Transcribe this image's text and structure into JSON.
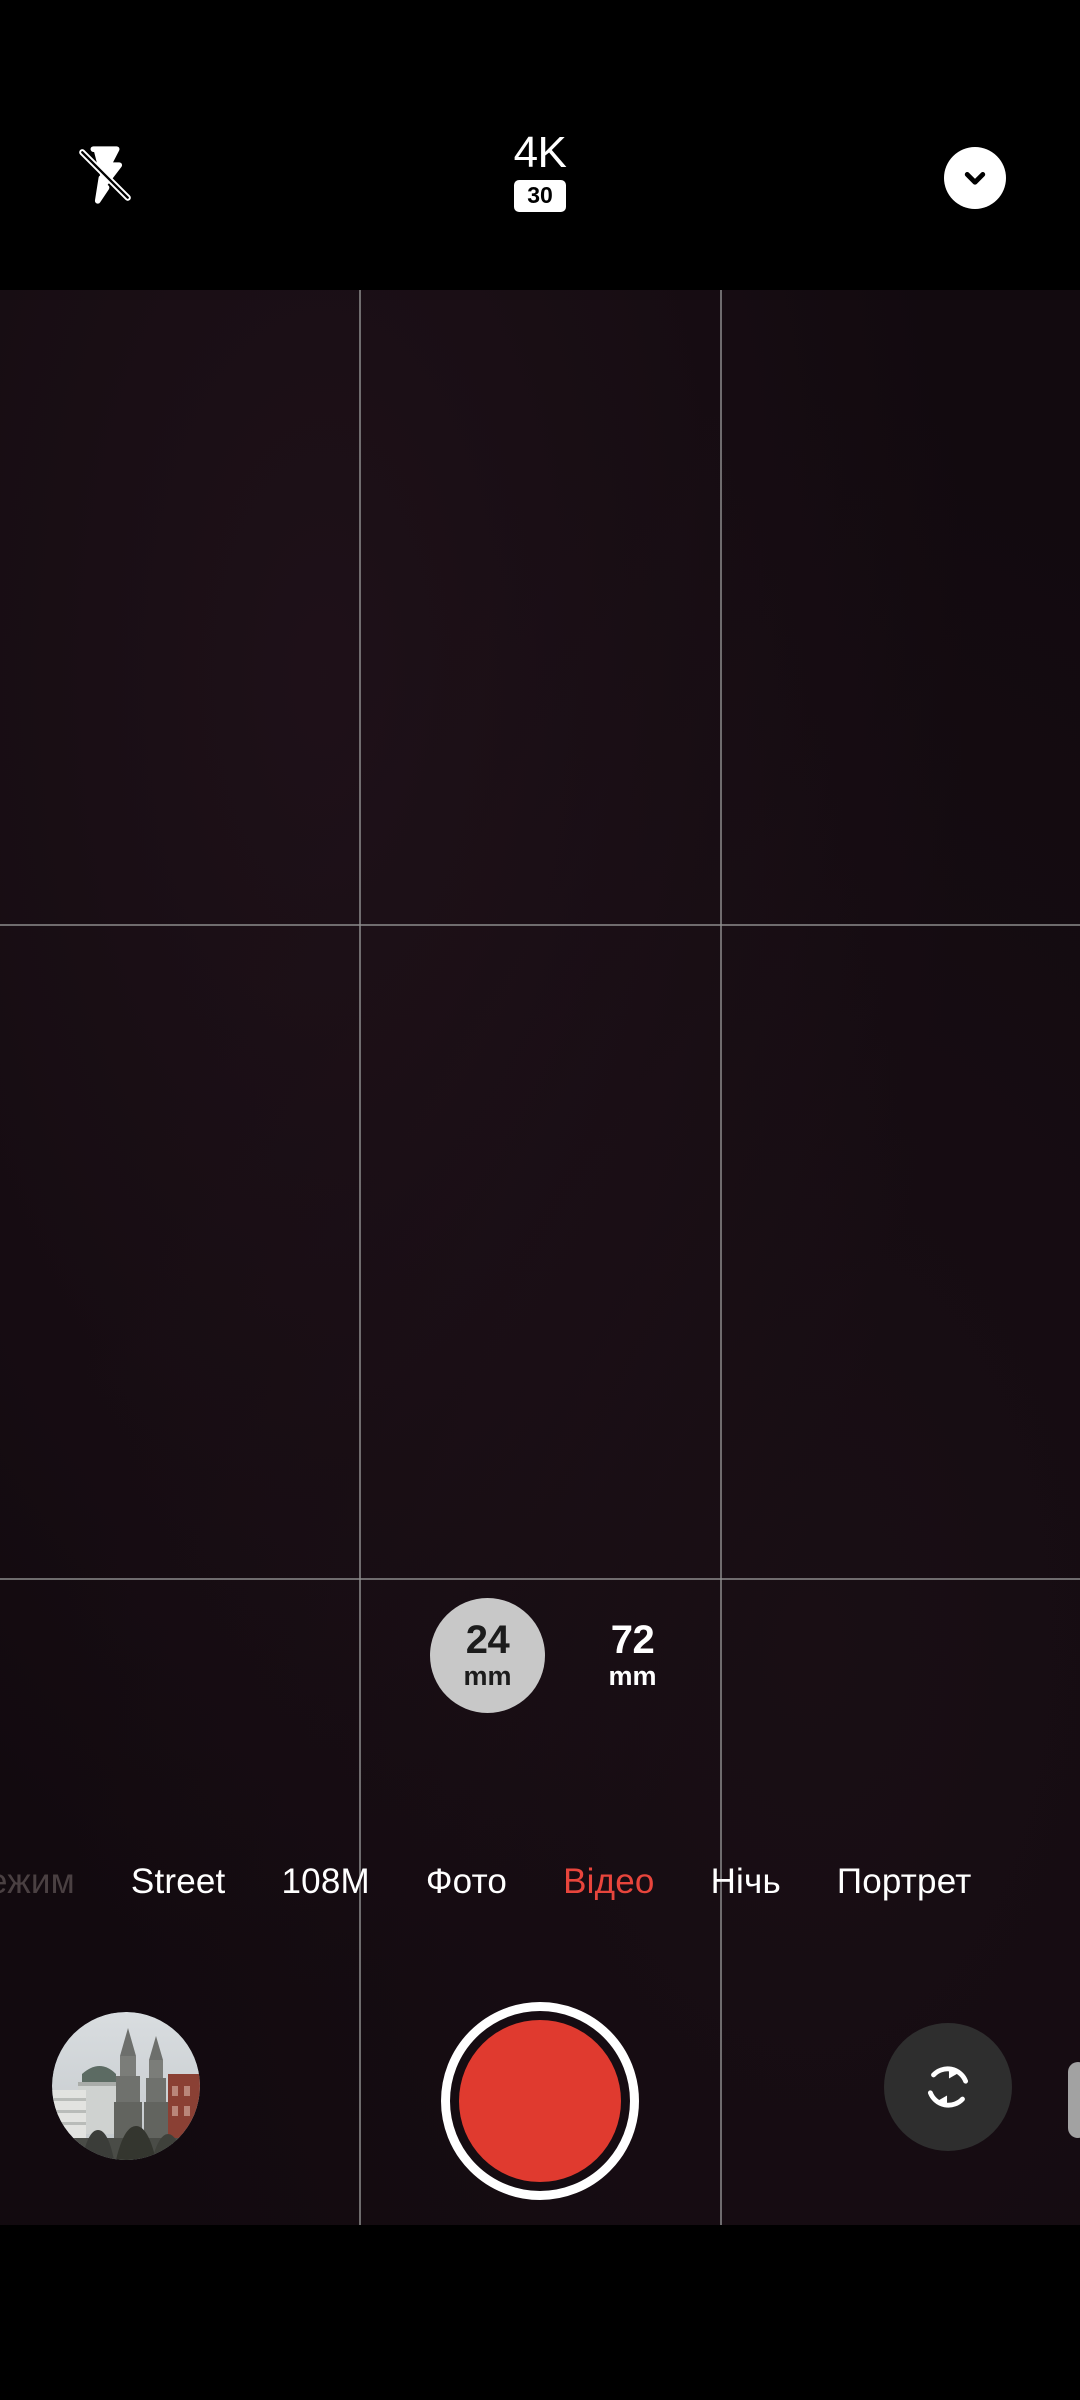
{
  "app": {
    "name": "Camera",
    "orientation": "portrait"
  },
  "status": {
    "privacy_indicator": "camera-in-use-dot",
    "privacy_color": "#1bd742"
  },
  "topbar": {
    "flash": {
      "icon": "flash-off-icon",
      "state": "off",
      "label": "Flash off"
    },
    "format": {
      "resolution": "4K",
      "fps": "30"
    },
    "expand": {
      "icon": "chevron-down-icon",
      "label": "More settings"
    }
  },
  "viewfinder": {
    "grid": {
      "enabled": true,
      "type": "3x3",
      "line_color": "#929292"
    },
    "background_color": "#120a0f"
  },
  "zoom": {
    "options": [
      {
        "value": "24",
        "unit": "mm",
        "selected": true
      },
      {
        "value": "72",
        "unit": "mm",
        "selected": false
      }
    ],
    "selected_color": "#c8c8c8"
  },
  "modes": {
    "active_color": "#e8453c",
    "items": [
      {
        "label": "Режим",
        "active": false,
        "cut_off": true
      },
      {
        "label": "Street",
        "active": false
      },
      {
        "label": "108M",
        "active": false
      },
      {
        "label": "Фото",
        "active": false
      },
      {
        "label": "Відео",
        "active": true
      },
      {
        "label": "Нічь",
        "active": false
      },
      {
        "label": "Портрет",
        "active": false
      }
    ]
  },
  "bottom": {
    "gallery": {
      "icon": "gallery-thumbnail",
      "label": "Last photo"
    },
    "shutter": {
      "icon": "record-button",
      "label": "Start recording",
      "color": "#e03a2f"
    },
    "flip": {
      "icon": "switch-camera-icon",
      "label": "Switch camera"
    },
    "drawer_handle": {
      "icon": "drag-handle",
      "label": "Panel handle"
    }
  }
}
